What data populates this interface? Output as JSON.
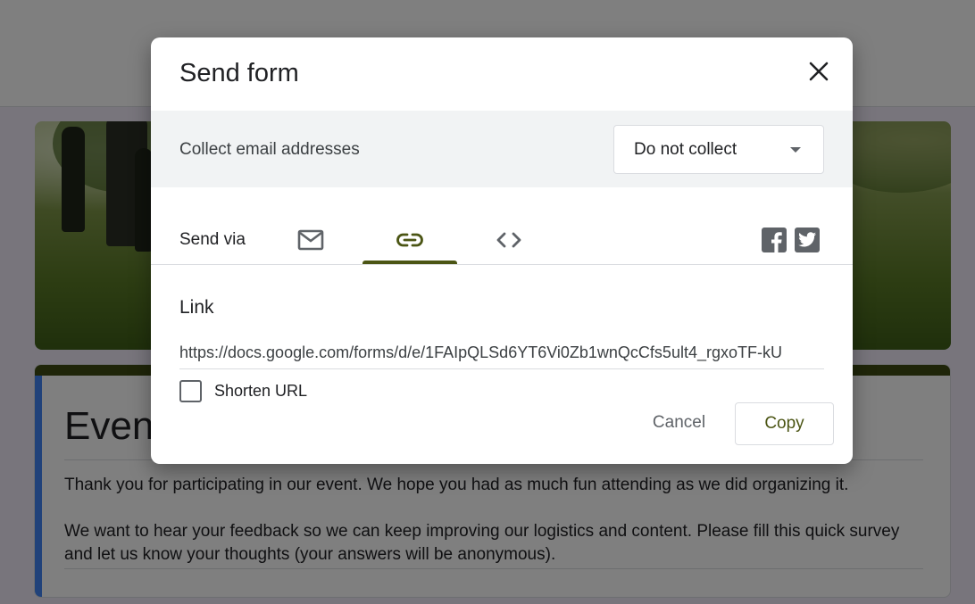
{
  "background": {
    "form_title": "Event",
    "form_description": "Thank you for participating in our event. We hope you had as much fun attending as we did organizing it.\n\nWe want to hear your feedback so we can keep improving our logistics and content. Please fill this quick survey and let us know your thoughts (your answers will be anonymous)."
  },
  "dialog": {
    "title": "Send form",
    "close_icon": "close-icon",
    "collect_email": {
      "label": "Collect email addresses",
      "selected": "Do not collect"
    },
    "send_via": {
      "label": "Send via",
      "tabs": [
        {
          "name": "email",
          "icon": "mail-icon",
          "active": false
        },
        {
          "name": "link",
          "icon": "link-icon",
          "active": true
        },
        {
          "name": "embed",
          "icon": "code-icon",
          "active": false
        }
      ],
      "social": [
        "facebook-icon",
        "twitter-icon"
      ]
    },
    "link": {
      "heading": "Link",
      "url": "https://docs.google.com/forms/d/e/1FAIpQLSd6YT6Vi0Zb1wnQcCfs5ult4_rgxoTF-kU",
      "shorten_label": "Shorten URL",
      "shorten_checked": false
    },
    "buttons": {
      "cancel": "Cancel",
      "copy": "Copy"
    }
  },
  "colors": {
    "accent": "#4b5514",
    "card_accent": "#4285f4"
  }
}
